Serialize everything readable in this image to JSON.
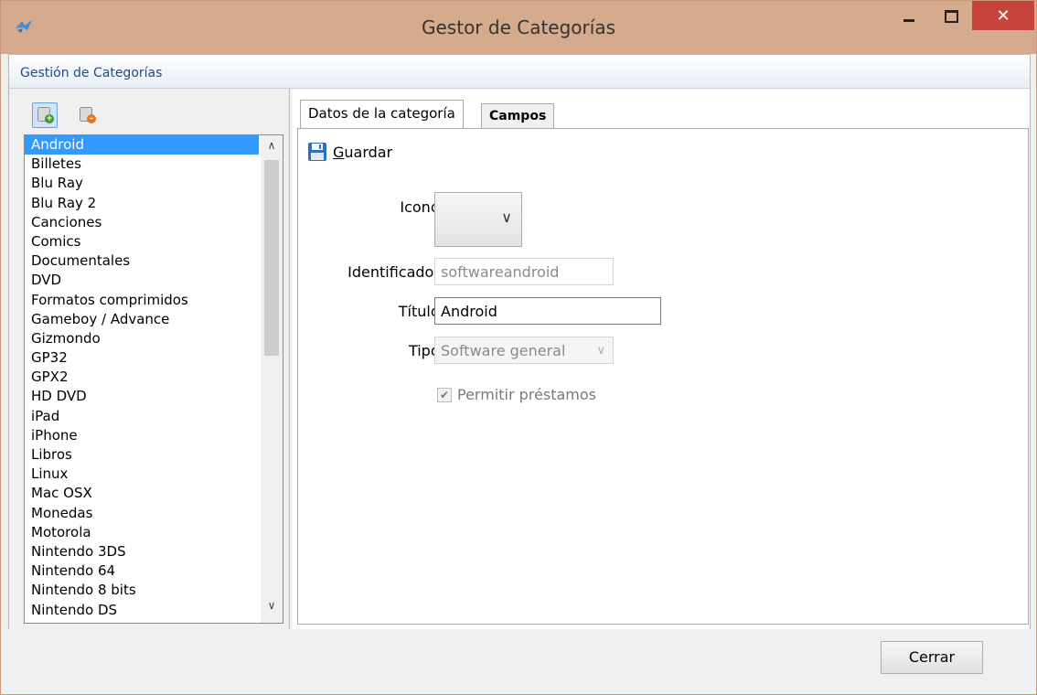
{
  "window": {
    "title": "Gestor de Categorías",
    "close_glyph": "✕"
  },
  "group": {
    "title": "Gestión de Categorías"
  },
  "toolbar": {
    "add_icon": "database-add-icon",
    "remove_icon": "database-remove-icon"
  },
  "categories": {
    "selected": "Android",
    "items": [
      "Android",
      "Billetes",
      "Blu Ray",
      "Blu Ray 2",
      "Canciones",
      "Comics",
      "Documentales",
      "DVD",
      "Formatos comprimidos",
      "Gameboy / Advance",
      "Gizmondo",
      "GP32",
      "GPX2",
      "HD DVD",
      "iPad",
      "iPhone",
      "Libros",
      "Linux",
      "Mac OSX",
      "Monedas",
      "Motorola",
      "Nintendo 3DS",
      "Nintendo 64",
      "Nintendo 8 bits",
      "Nintendo DS"
    ]
  },
  "tabs": [
    {
      "label": "Datos de la categoría",
      "active": true
    },
    {
      "label": "Campos",
      "active": false
    }
  ],
  "form": {
    "save_label": "Guardar",
    "icon_label": "Icono:",
    "id_label": "Identificador:",
    "id_value": "softwareandroid",
    "title_label": "Título:",
    "title_value": "Android",
    "type_label": "Tipo:",
    "type_value": "Software general",
    "loans_label": "Permitir préstamos",
    "loans_checked": true
  },
  "footer": {
    "close_label": "Cerrar"
  },
  "colors": {
    "titlebar": "#d6aa8d",
    "selection": "#3399ff",
    "close_button": "#c6443b",
    "group_title": "#1e4b89"
  }
}
